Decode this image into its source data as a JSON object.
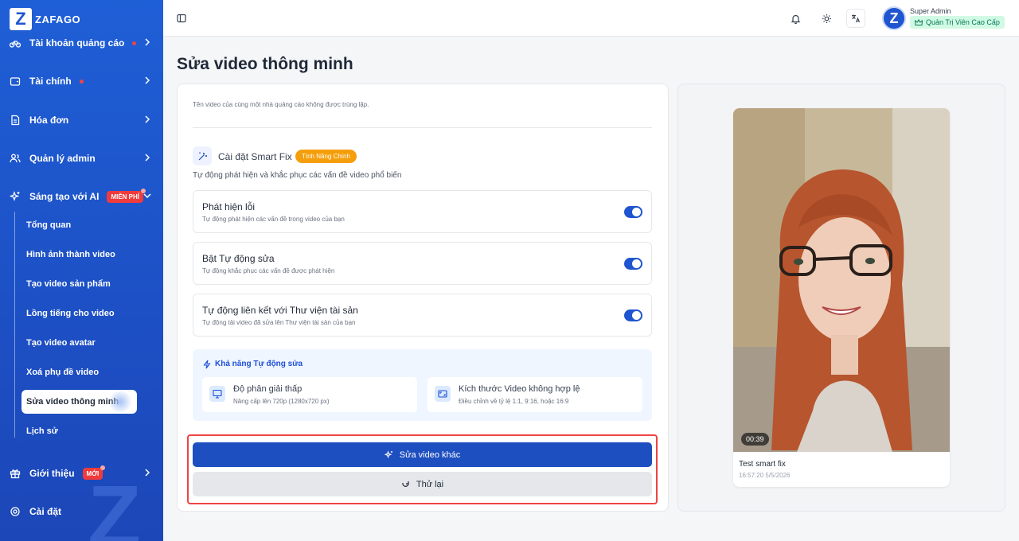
{
  "brand": {
    "logo_letter": "Z",
    "name": "ZAFAGO"
  },
  "sidebar": {
    "items": [
      {
        "label": "Tài khoản quảng cáo",
        "icon": "bicycle-icon",
        "dot": true
      },
      {
        "label": "Tài chính",
        "icon": "wallet-icon",
        "dot": true
      },
      {
        "label": "Hóa đơn",
        "icon": "receipt-icon"
      },
      {
        "label": "Quản lý admin",
        "icon": "users-icon"
      },
      {
        "label": "Sáng tạo với AI",
        "icon": "sparkle-icon",
        "badge": "MIỄN PHÍ"
      }
    ],
    "sub_items": [
      {
        "label": "Tổng quan"
      },
      {
        "label": "Hình ảnh thành video"
      },
      {
        "label": "Tạo video sản phẩm"
      },
      {
        "label": "Lồng tiếng cho video"
      },
      {
        "label": "Tạo video avatar"
      },
      {
        "label": "Xoá phụ đề video"
      },
      {
        "label": "Sửa video thông minh"
      },
      {
        "label": "Lịch sử"
      }
    ],
    "intro": {
      "label": "Giới thiệu",
      "badge": "MỚI"
    },
    "settings": {
      "label": "Cài đặt"
    }
  },
  "topbar": {
    "user_name": "Super Admin",
    "role": "Quản Trị Viên Cao Cấp",
    "avatar_letter": "Z"
  },
  "page": {
    "title": "Sửa video thông minh"
  },
  "form": {
    "hint": "Tên video của cùng một nhà quảng cáo không được trùng lặp.",
    "smart_fix": {
      "title": "Cài đặt Smart Fix",
      "badge": "Tính Năng Chính",
      "subtitle": "Tự động phát hiện và khắc phục các vấn đề video phổ biến"
    },
    "options": [
      {
        "title": "Phát hiện lỗi",
        "desc": "Tự động phát hiện các vấn đề trong video của bạn",
        "enabled": true
      },
      {
        "title": "Bật Tự động sửa",
        "desc": "Tự động khắc phục các vấn đề được phát hiện",
        "enabled": true
      },
      {
        "title": "Tự động liên kết với Thư viện tài sản",
        "desc": "Tự động tải video đã sửa lên Thư viện tài sản của bạn",
        "enabled": true
      }
    ],
    "capabilities": {
      "title": "Khả năng Tự động sửa",
      "items": [
        {
          "title": "Độ phân giải thấp",
          "desc": "Nâng cấp lên 720p (1280x720 px)"
        },
        {
          "title": "Kích thước Video không hợp lệ",
          "desc": "Điều chỉnh về tỷ lệ 1:1, 9:16, hoặc 16:9"
        }
      ]
    },
    "primary_button": "Sửa video khác",
    "secondary_button": "Thử lại"
  },
  "video": {
    "duration": "00:39",
    "title": "Test smart fix",
    "date": "16:57:20 5/5/2026"
  },
  "colors": {
    "primary": "#1e4fc0",
    "accent_orange": "#f59e0b",
    "danger": "#ef4444",
    "success_bg": "#d1fae5"
  }
}
